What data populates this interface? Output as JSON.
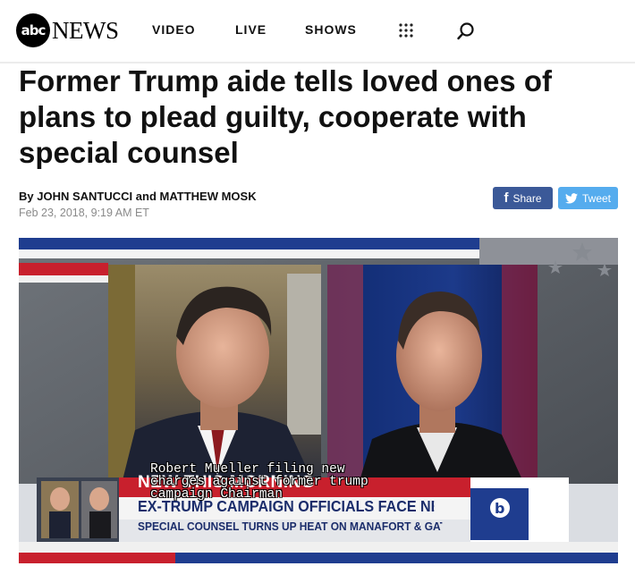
{
  "header": {
    "logo_badge": "abc",
    "logo_word": "NEWS",
    "nav": [
      {
        "label": "VIDEO"
      },
      {
        "label": "LIVE"
      },
      {
        "label": "SHOWS"
      }
    ],
    "icons": {
      "menu": "grid-dots-icon",
      "search": "search-icon"
    }
  },
  "article": {
    "headline": "Former Trump aide tells loved ones of plans to plead guilty, cooperate with special counsel",
    "byline": {
      "prefix": "By",
      "author1": "JOHN SANTUCCI",
      "conjunction": "and",
      "author2": "MATTHEW MOSK"
    },
    "date": "Feb 23, 2018, 9:19 AM ET",
    "share": {
      "facebook": "Share",
      "twitter": "Tweet"
    }
  },
  "video": {
    "caption": "Robert Mueller filing new\ncharges against former trump\ncampaign Chairman",
    "lower_third": {
      "title": "NEW THIS MORNING",
      "line2": "EX-TRUMP CAMPAIGN OFFICIALS FACE NEW CHARGES",
      "line3": "SPECIAL COUNSEL TURNS UP HEAT ON MANAFORT & GATES"
    }
  },
  "colors": {
    "facebook": "#3b5998",
    "twitter": "#55acee",
    "graphic_blue": "#1f3d8f",
    "graphic_red": "#c8202d"
  }
}
